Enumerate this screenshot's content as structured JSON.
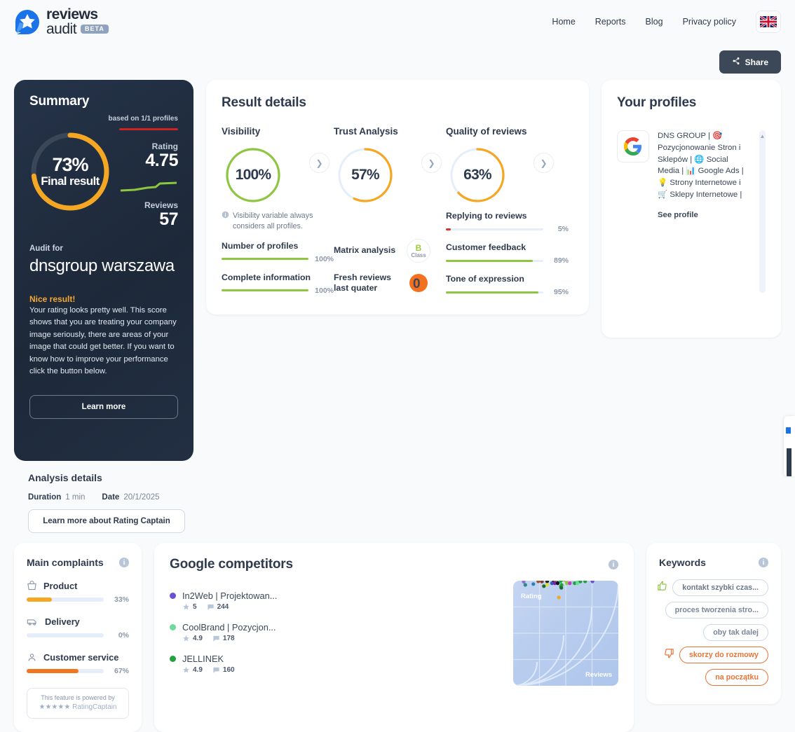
{
  "brand": {
    "name_line1": "reviews",
    "name_line2": "audit",
    "badge": "BETA",
    "logo_icon": "star-review-logo-icon",
    "accent": "#1a73e8"
  },
  "nav": {
    "items": [
      {
        "label": "Home"
      },
      {
        "label": "Reports"
      },
      {
        "label": "Blog"
      },
      {
        "label": "Privacy policy"
      }
    ],
    "language_flag": "uk-flag-icon"
  },
  "toolbar": {
    "share_label": "Share",
    "share_icon": "share-icon"
  },
  "summary": {
    "title": "Summary",
    "based_on": "based on 1/1 profiles",
    "donut": {
      "value": 73,
      "value_label": "73%",
      "caption": "Final result",
      "color": "#f5a623",
      "track": "#3c4858"
    },
    "stats": [
      {
        "label": "Rating",
        "value": "4.75",
        "spark_color": "#cf2222"
      },
      {
        "label": "Reviews",
        "value": "57",
        "spark_color": "#8ec63f"
      }
    ],
    "audit_for_label": "Audit for",
    "audit_name": "dnsgroup warszawa",
    "verdict_title": "Nice result!",
    "verdict_body": "Your rating looks pretty well. This score shows that you are treating your company image seriously, there are areas of your image that could get better. If you want to know how to improve your performance click the button below.",
    "learn_more_label": "Learn more"
  },
  "analysis_details": {
    "title": "Analysis details",
    "duration_label": "Duration",
    "duration_value": "1 min",
    "date_label": "Date",
    "date_value": "20/1/2025",
    "button_label": "Learn more about Rating Captain"
  },
  "result_details": {
    "title": "Result details",
    "gauges": [
      {
        "title": "Visibility",
        "value": 100,
        "value_label": "100%",
        "color": "#8ec63f",
        "chevron_icon": "chevron-right-icon"
      },
      {
        "title": "Trust Analysis",
        "value": 57,
        "value_label": "57%",
        "color": "#f5a623",
        "chevron_icon": "chevron-right-icon"
      },
      {
        "title": "Quality of reviews",
        "value": 63,
        "value_label": "63%",
        "color": "#f5a623",
        "chevron_icon": "chevron-right-icon"
      }
    ],
    "visibility_note": "Visibility variable always considers all profiles.",
    "visibility_note_icon": "info-icon",
    "visibility_bars": [
      {
        "label": "Number of profiles",
        "value": 100,
        "value_label": "100%",
        "color": "#8ec63f"
      },
      {
        "label": "Complete information",
        "value": 100,
        "value_label": "100%",
        "color": "#8ec63f"
      }
    ],
    "trust_items": [
      {
        "label": "Matrix analysis",
        "badge_letter": "B",
        "badge_word": "Class"
      },
      {
        "label": "Fresh reviews last quater",
        "badge_value": "0",
        "badge_icon": "orange-circle-zero-icon"
      }
    ],
    "quality_bars": [
      {
        "label": "Replying to reviews",
        "value": 5,
        "value_label": "5%",
        "color": "#e03030"
      },
      {
        "label": "Customer feedback",
        "value": 89,
        "value_label": "89%",
        "color": "#8ec63f"
      },
      {
        "label": "Tone of expression",
        "value": 95,
        "value_label": "95%",
        "color": "#8ec63f"
      }
    ]
  },
  "profiles": {
    "title": "Your profiles",
    "items": [
      {
        "source_icon": "google-g-icon",
        "name": "DNS GROUP | 🎯 Pozycjonowanie Stron i Sklepów | 🌐 Social Media | 📊 Google Ads | 💡 Strony Internetowe i 🛒 Sklepy Internetowe |",
        "link_label": "See profile"
      }
    ],
    "scrollbar_icon": "chevron-up-icon"
  },
  "complaints": {
    "title": "Main complaints",
    "info_icon": "info-icon",
    "items": [
      {
        "label": "Product",
        "icon": "basket-icon",
        "value": 33,
        "value_label": "33%",
        "color": "#f5a623"
      },
      {
        "label": "Delivery",
        "icon": "truck-icon",
        "value": 0,
        "value_label": "0%",
        "color": "#f5a623"
      },
      {
        "label": "Customer service",
        "icon": "person-icon",
        "value": 67,
        "value_label": "67%",
        "color": "#f0761f"
      }
    ],
    "powered_by_line1": "This feature is powered by",
    "powered_by_line2": "★★★★★ RatingCaptain"
  },
  "competitors": {
    "title": "Google competitors",
    "info_icon": "info-icon",
    "items": [
      {
        "name": "In2Web | Projektowan...",
        "rating": "5",
        "reviews": "244",
        "color": "#6b4fd4"
      },
      {
        "name": "CoolBrand | Pozycjon...",
        "rating": "4.9",
        "reviews": "178",
        "color": "#6ddc9a"
      },
      {
        "name": "JELLINEK",
        "rating": "4.9",
        "reviews": "160",
        "color": "#20a33c"
      }
    ],
    "star_icon": "star-icon",
    "comment_icon": "comment-icon",
    "chart_axis_y": "Rating",
    "chart_axis_x": "Reviews"
  },
  "keywords": {
    "title": "Keywords",
    "info_icon": "info-icon",
    "items": [
      {
        "label": "kontakt szybki czas...",
        "sentiment": "positive",
        "icon": "thumbs-up-icon"
      },
      {
        "label": "proces tworzenia stro...",
        "sentiment": "positive",
        "icon": ""
      },
      {
        "label": "oby tak dalej",
        "sentiment": "positive",
        "icon": ""
      },
      {
        "label": "skorzy do rozmowy",
        "sentiment": "negative",
        "icon": "thumbs-down-icon"
      },
      {
        "label": "na początku",
        "sentiment": "negative",
        "icon": ""
      }
    ]
  },
  "chart_data": {
    "type": "scatter",
    "title": "Google competitors",
    "xlabel": "Reviews",
    "ylabel": "Rating",
    "grid": true,
    "xlim": [
      0,
      260
    ],
    "ylim": [
      0,
      5
    ],
    "points": [
      {
        "x": 26,
        "y": 4.95,
        "color": "#9b6ddc"
      },
      {
        "x": 62,
        "y": 4.97,
        "color": "#a0522d"
      },
      {
        "x": 71,
        "y": 4.96,
        "color": "#8b3a2a"
      },
      {
        "x": 84,
        "y": 4.97,
        "color": "#222222"
      },
      {
        "x": 100,
        "y": 4.96,
        "color": "#333333"
      },
      {
        "x": 105,
        "y": 4.97,
        "color": "#c86428"
      },
      {
        "x": 113,
        "y": 4.96,
        "color": "#1fbfbf"
      },
      {
        "x": 119,
        "y": 4.97,
        "color": "#20a33c"
      },
      {
        "x": 126,
        "y": 4.96,
        "color": "#88cc44"
      },
      {
        "x": 134,
        "y": 4.97,
        "color": "#e8a0c8"
      },
      {
        "x": 141,
        "y": 4.96,
        "color": "#c8c8c8"
      },
      {
        "x": 160,
        "y": 4.97,
        "color": "#6ddc9a"
      },
      {
        "x": 166,
        "y": 4.96,
        "color": "#20a33c"
      },
      {
        "x": 178,
        "y": 4.97,
        "color": "#20a33c"
      },
      {
        "x": 196,
        "y": 4.97,
        "color": "#6b4fd4"
      },
      {
        "x": 96,
        "y": 4.88,
        "color": "#3355cc"
      },
      {
        "x": 103,
        "y": 4.88,
        "color": "#7722aa"
      },
      {
        "x": 110,
        "y": 4.88,
        "color": "#111111"
      },
      {
        "x": 124,
        "y": 4.88,
        "color": "#e0e0e0"
      },
      {
        "x": 133,
        "y": 4.88,
        "color": "#88cc44"
      },
      {
        "x": 140,
        "y": 4.88,
        "color": "#cc33cc"
      },
      {
        "x": 152,
        "y": 4.88,
        "color": "#20a33c"
      },
      {
        "x": 159,
        "y": 4.88,
        "color": "#6ddc9a"
      },
      {
        "x": 30,
        "y": 4.8,
        "color": "#2b8a8a"
      },
      {
        "x": 50,
        "y": 4.84,
        "color": "#2b7fb5"
      },
      {
        "x": 84,
        "y": 4.81,
        "color": "#dede3a"
      },
      {
        "x": 120,
        "y": 4.8,
        "color": "#20a33c"
      },
      {
        "x": 76,
        "y": 4.74,
        "color": "#1d6b2a"
      },
      {
        "x": 118,
        "y": 4.73,
        "color": "#20a33c"
      },
      {
        "x": 119,
        "y": 4.66,
        "color": "#1d6b2a"
      },
      {
        "x": 113,
        "y": 4.2,
        "color": "#f5a623"
      }
    ]
  }
}
